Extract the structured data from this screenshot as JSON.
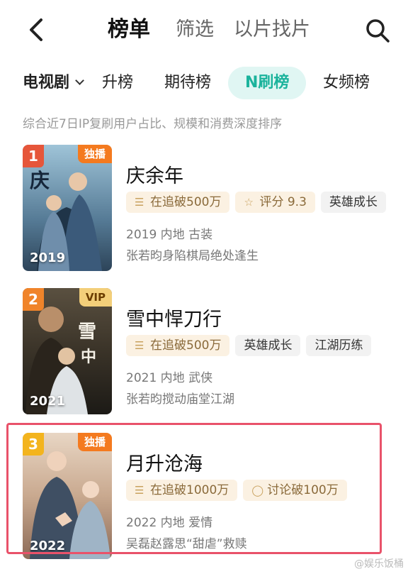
{
  "header": {
    "back_icon": "chevron-left-icon",
    "tabs": [
      {
        "label": "榜单",
        "active": true
      },
      {
        "label": "筛选",
        "active": false
      },
      {
        "label": "以片找片",
        "active": false
      }
    ],
    "search_icon": "search-icon"
  },
  "filter_tabs": {
    "category": "电视剧",
    "items": [
      "升榜",
      "期待榜",
      "N刷榜",
      "女频榜"
    ],
    "active": "N刷榜",
    "accent_color": "#1bb39c"
  },
  "subtitle": "综合近7日IP复刷用户占比、规模和消费深度排序",
  "rank_colors": {
    "1": "#e6563a",
    "2": "#f0842a",
    "3": "#f3b41e"
  },
  "items": [
    {
      "rank": "1",
      "badge": "独播",
      "year": "2019",
      "title": "庆余年",
      "chips": [
        {
          "icon": "trending-icon",
          "text": "在追破500万"
        },
        {
          "icon": "star-icon",
          "text": "评分 9.3"
        },
        {
          "icon": "",
          "text": "英雄成长"
        }
      ],
      "meta": "2019 内地 古装",
      "desc": "张若昀身陷棋局绝处逢生"
    },
    {
      "rank": "2",
      "badge": "VIP",
      "year": "2021",
      "title": "雪中悍刀行",
      "chips": [
        {
          "icon": "trending-icon",
          "text": "在追破500万"
        },
        {
          "icon": "",
          "text": "英雄成长"
        },
        {
          "icon": "",
          "text": "江湖历练"
        }
      ],
      "meta": "2021 内地 武侠",
      "desc": "张若昀搅动庙堂江湖"
    },
    {
      "rank": "3",
      "badge": "独播",
      "year": "2022",
      "title": "月升沧海",
      "chips": [
        {
          "icon": "trending-icon",
          "text": "在追破1000万"
        },
        {
          "icon": "comment-icon",
          "text": "讨论破100万"
        }
      ],
      "meta": "2022 内地 爱情",
      "desc": "吴磊赵露思“甜虐”救赎"
    }
  ],
  "watermark": "@娱乐饭桶"
}
